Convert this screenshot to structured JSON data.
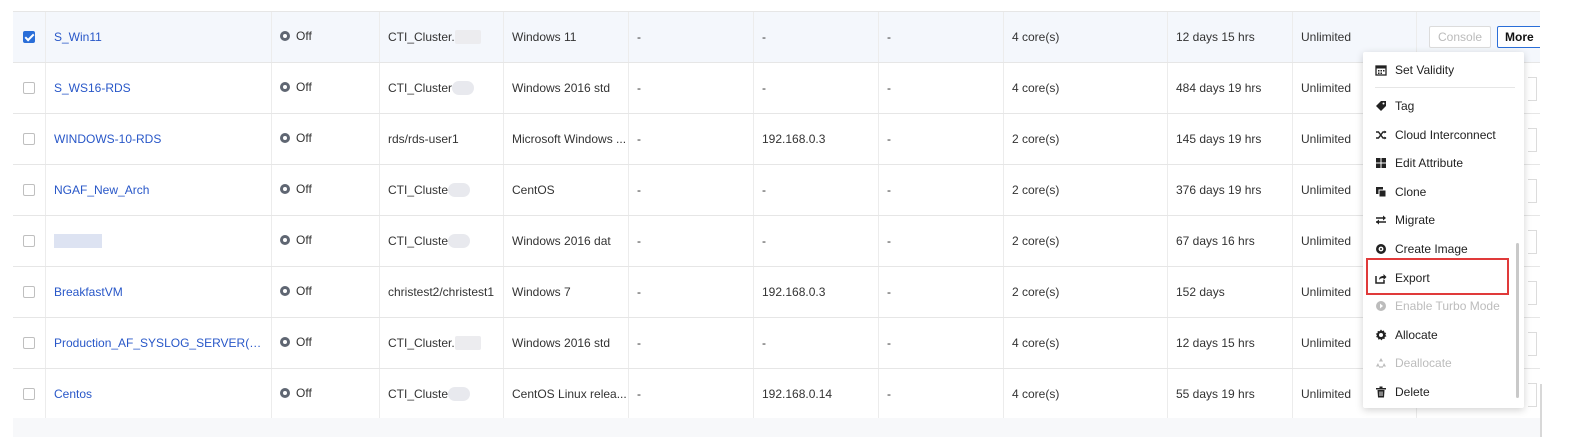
{
  "rows": [
    {
      "checked": true,
      "name": "S_Win11",
      "status": "Off",
      "cluster": "CTI_Cluster.",
      "os": "Windows 11",
      "col5": "-",
      "ip": "-",
      "col7": "-",
      "cpu": "4 core(s)",
      "validity": "12 days 15 hrs",
      "quota": "Unlimited"
    },
    {
      "checked": false,
      "name": "S_WS16-RDS",
      "status": "Off",
      "cluster": "CTI_Cluster",
      "os": "Windows 2016 std",
      "col5": "-",
      "ip": "-",
      "col7": "-",
      "cpu": "4 core(s)",
      "validity": "484 days 19 hrs",
      "quota": "Unlimited"
    },
    {
      "checked": false,
      "name": "WINDOWS-10-RDS",
      "status": "Off",
      "cluster": "rds/rds-user1",
      "os": "Microsoft Windows ...",
      "col5": "-",
      "ip": "192.168.0.3",
      "col7": "-",
      "cpu": "2 core(s)",
      "validity": "145 days 19 hrs",
      "quota": "Unlimited"
    },
    {
      "checked": false,
      "name": "NGAF_New_Arch",
      "status": "Off",
      "cluster": "CTI_Cluste",
      "os": "CentOS",
      "col5": "-",
      "ip": "-",
      "col7": "-",
      "cpu": "2 core(s)",
      "validity": "376 days 19 hrs",
      "quota": "Unlimited"
    },
    {
      "checked": false,
      "name": "",
      "status": "Off",
      "cluster": "CTI_Cluste",
      "os": "Windows 2016 dat",
      "col5": "-",
      "ip": "-",
      "col7": "-",
      "cpu": "2 core(s)",
      "validity": "67 days 16 hrs",
      "quota": "Unlimited"
    },
    {
      "checked": false,
      "name": "BreakfastVM",
      "status": "Off",
      "cluster": "christest2/christest1",
      "os": "Windows 7",
      "col5": "-",
      "ip": "192.168.0.3",
      "col7": "-",
      "cpu": "2 core(s)",
      "validity": "152 days",
      "quota": "Unlimited"
    },
    {
      "checked": false,
      "name": "Production_AF_SYSLOG_SERVER(DO_...",
      "status": "Off",
      "cluster": "CTI_Cluster.",
      "os": "Windows 2016 std",
      "col5": "-",
      "ip": "-",
      "col7": "-",
      "cpu": "4 core(s)",
      "validity": "12 days 15 hrs",
      "quota": "Unlimited"
    },
    {
      "checked": false,
      "name": "Centos",
      "status": "Off",
      "cluster": "CTI_Cluste",
      "os": "CentOS Linux relea...",
      "col5": "-",
      "ip": "192.168.0.14",
      "col7": "-",
      "cpu": "4 core(s)",
      "validity": "55 days 19 hrs",
      "quota": "Unlimited"
    }
  ],
  "actions": {
    "console_label": "Console",
    "more_label": "More"
  },
  "menu": {
    "items": [
      {
        "label": "Set Validity",
        "icon": "calendar-icon",
        "disabled": false
      },
      {
        "label": "Tag",
        "icon": "tag-icon",
        "disabled": false
      },
      {
        "label": "Cloud Interconnect",
        "icon": "shuffle-icon",
        "disabled": false
      },
      {
        "label": "Edit Attribute",
        "icon": "grid-icon",
        "disabled": false
      },
      {
        "label": "Clone",
        "icon": "copy-icon",
        "disabled": false
      },
      {
        "label": "Migrate",
        "icon": "swap-arrows-icon",
        "disabled": false
      },
      {
        "label": "Create Image",
        "icon": "disc-icon",
        "disabled": false
      },
      {
        "label": "Export",
        "icon": "export-icon",
        "disabled": false,
        "highlighted": true
      },
      {
        "label": "Enable Turbo Mode",
        "icon": "turbo-icon",
        "disabled": true
      },
      {
        "label": "Allocate",
        "icon": "gear-icon",
        "disabled": false
      },
      {
        "label": "Deallocate",
        "icon": "recycle-icon",
        "disabled": true
      },
      {
        "label": "Delete",
        "icon": "trash-icon",
        "disabled": false
      }
    ]
  },
  "colors": {
    "link": "#2857c8",
    "accent": "#2a6ed8",
    "highlight_border": "#e03a3a",
    "selected_row": "#f4f7fc"
  }
}
